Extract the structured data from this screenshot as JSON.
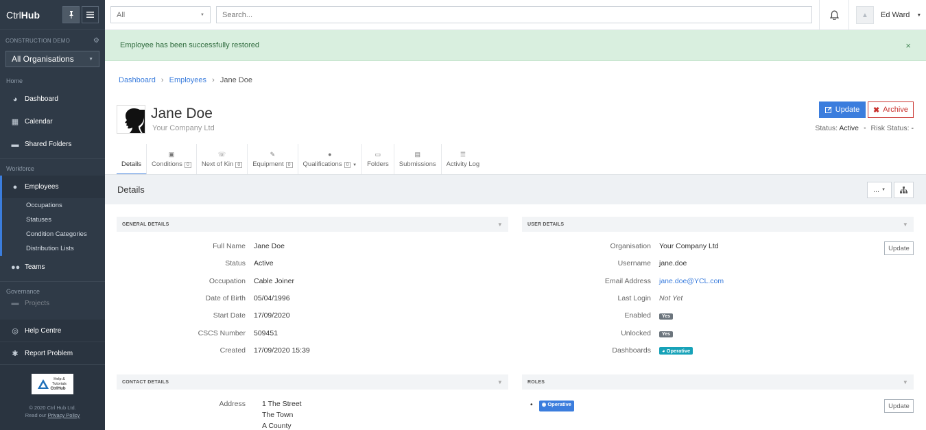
{
  "app": {
    "brand_light": "Ctrl",
    "brand_bold": "Hub"
  },
  "sidebar": {
    "demo_label": "CONSTRUCTION DEMO",
    "org_select": "All Organisations",
    "section_home": "Home",
    "dashboard": "Dashboard",
    "calendar": "Calendar",
    "shared_folders": "Shared Folders",
    "section_workforce": "Workforce",
    "employees": "Employees",
    "occupations": "Occupations",
    "statuses": "Statuses",
    "condition_categories": "Condition Categories",
    "distribution_lists": "Distribution Lists",
    "teams": "Teams",
    "section_governance": "Governance",
    "projects": "Projects",
    "help_centre": "Help Centre",
    "report_problem": "Report Problem",
    "logo_text": "CtrlHub",
    "logo_help": "Help & Tutorials",
    "copyright": "© 2020 Ctrl Hub Ltd.",
    "policy_prefix": "Read our ",
    "policy_link": "Privacy Policy"
  },
  "topbar": {
    "filter": "All",
    "search_placeholder": "Search...",
    "user_name": "Ed Ward"
  },
  "alert": {
    "message": "Employee has been successfully restored",
    "close": "×"
  },
  "breadcrumb": {
    "dashboard": "Dashboard",
    "employees": "Employees",
    "current": "Jane Doe",
    "sep": "›"
  },
  "employee": {
    "name": "Jane Doe",
    "company": "Your Company Ltd",
    "update": "Update",
    "archive": "Archive",
    "status_label": "Status:",
    "status_value": "Active",
    "risk_label": "Risk Status:",
    "risk_value": "-"
  },
  "tabs": {
    "details": "Details",
    "conditions": "Conditions",
    "conditions_count": "0",
    "next_of_kin": "Next of Kin",
    "next_of_kin_count": "0",
    "equipment": "Equipment",
    "equipment_count": "0",
    "qualifications": "Qualifications",
    "qualifications_count": "0",
    "folders": "Folders",
    "submissions": "Submissions",
    "activity_log": "Activity Log"
  },
  "details": {
    "title": "Details",
    "more": "...",
    "general_title": "GENERAL DETAILS",
    "user_title": "USER DETAILS",
    "contact_title": "CONTACT DETAILS",
    "roles_title": "ROLES",
    "general": [
      {
        "label": "Full Name",
        "value": "Jane Doe"
      },
      {
        "label": "Status",
        "value": "Active"
      },
      {
        "label": "Occupation",
        "value": "Cable Joiner"
      },
      {
        "label": "Date of Birth",
        "value": "05/04/1996"
      },
      {
        "label": "Start Date",
        "value": "17/09/2020"
      },
      {
        "label": "CSCS Number",
        "value": "509451"
      },
      {
        "label": "Created",
        "value": "17/09/2020 15:39"
      }
    ],
    "user": {
      "organisation_label": "Organisation",
      "organisation": "Your Company Ltd",
      "username_label": "Username",
      "username": "jane.doe",
      "email_label": "Email Address",
      "email": "jane.doe@YCL.com",
      "last_login_label": "Last Login",
      "last_login": "Not Yet",
      "enabled_label": "Enabled",
      "enabled": "Yes",
      "unlocked_label": "Unlocked",
      "unlocked": "Yes",
      "dashboards_label": "Dashboards",
      "dashboards": "Operative",
      "update": "Update"
    },
    "contact": {
      "address_label": "Address",
      "address": [
        "1 The Street",
        "The Town",
        "A County"
      ]
    },
    "roles": {
      "role": "Operative",
      "update": "Update"
    }
  }
}
